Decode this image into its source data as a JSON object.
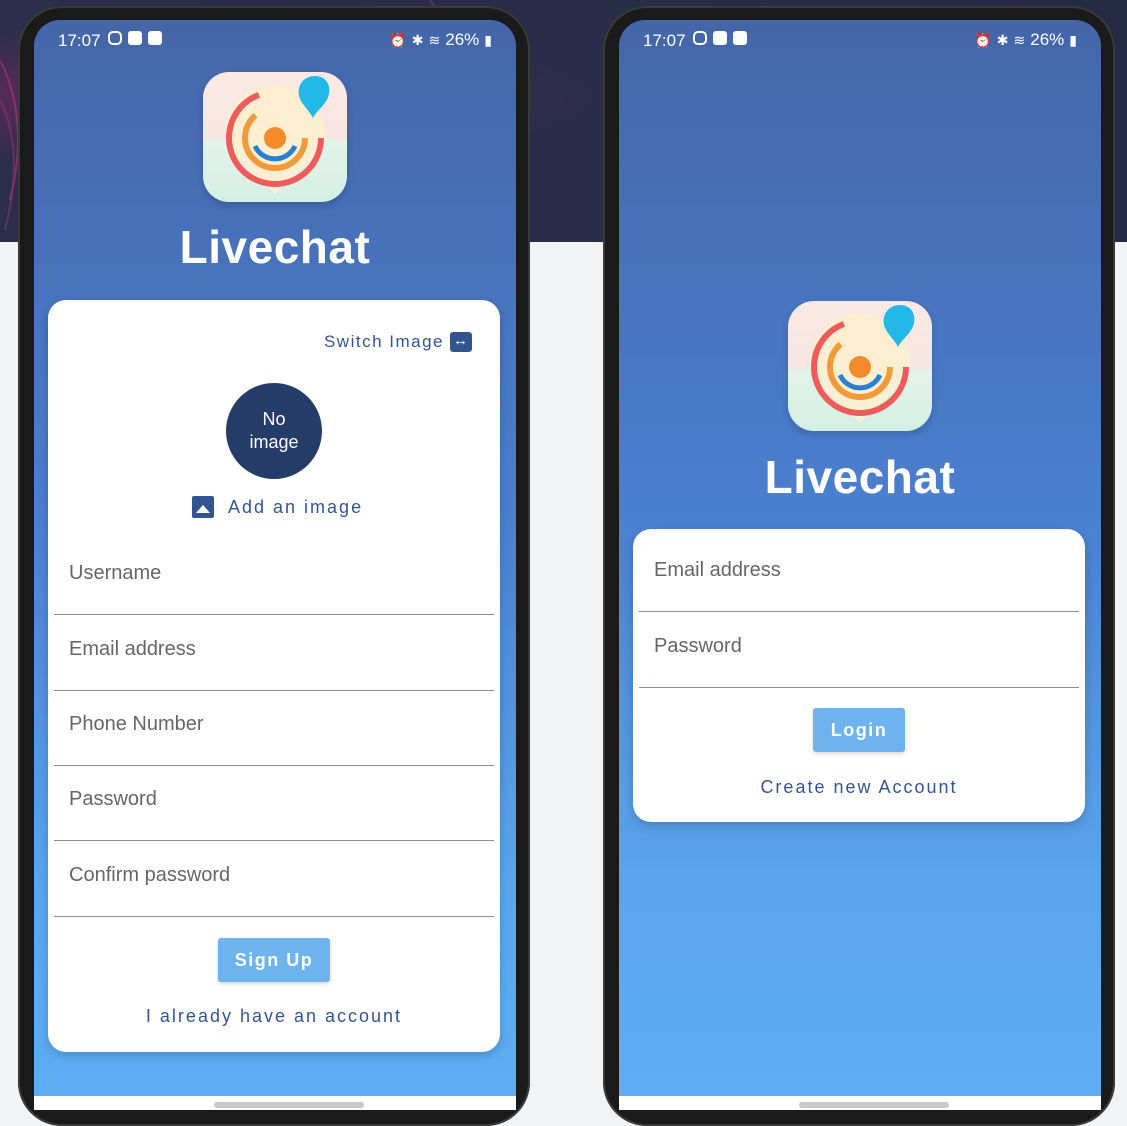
{
  "colors": {
    "accent": "#33558f",
    "button": "#6db3ee",
    "avatar_bg": "#253b68",
    "screen_top": "#4466a8",
    "screen_bottom": "#5eaef4"
  },
  "status_bar": {
    "time": "17:07",
    "battery": "26%"
  },
  "app": {
    "name": "Livechat"
  },
  "signup": {
    "switch_image_label": "Switch Image",
    "avatar_text_line1": "No",
    "avatar_text_line2": "image",
    "add_image_label": "Add an image",
    "fields": [
      {
        "label": "Username"
      },
      {
        "label": "Email address"
      },
      {
        "label": "Phone Number"
      },
      {
        "label": "Password"
      },
      {
        "label": "Confirm password"
      }
    ],
    "submit_label": "Sign Up",
    "alt_link_label": "I already have an account"
  },
  "login": {
    "fields": [
      {
        "label": "Email address"
      },
      {
        "label": "Password"
      }
    ],
    "submit_label": "Login",
    "alt_link_label": "Create new Account"
  }
}
